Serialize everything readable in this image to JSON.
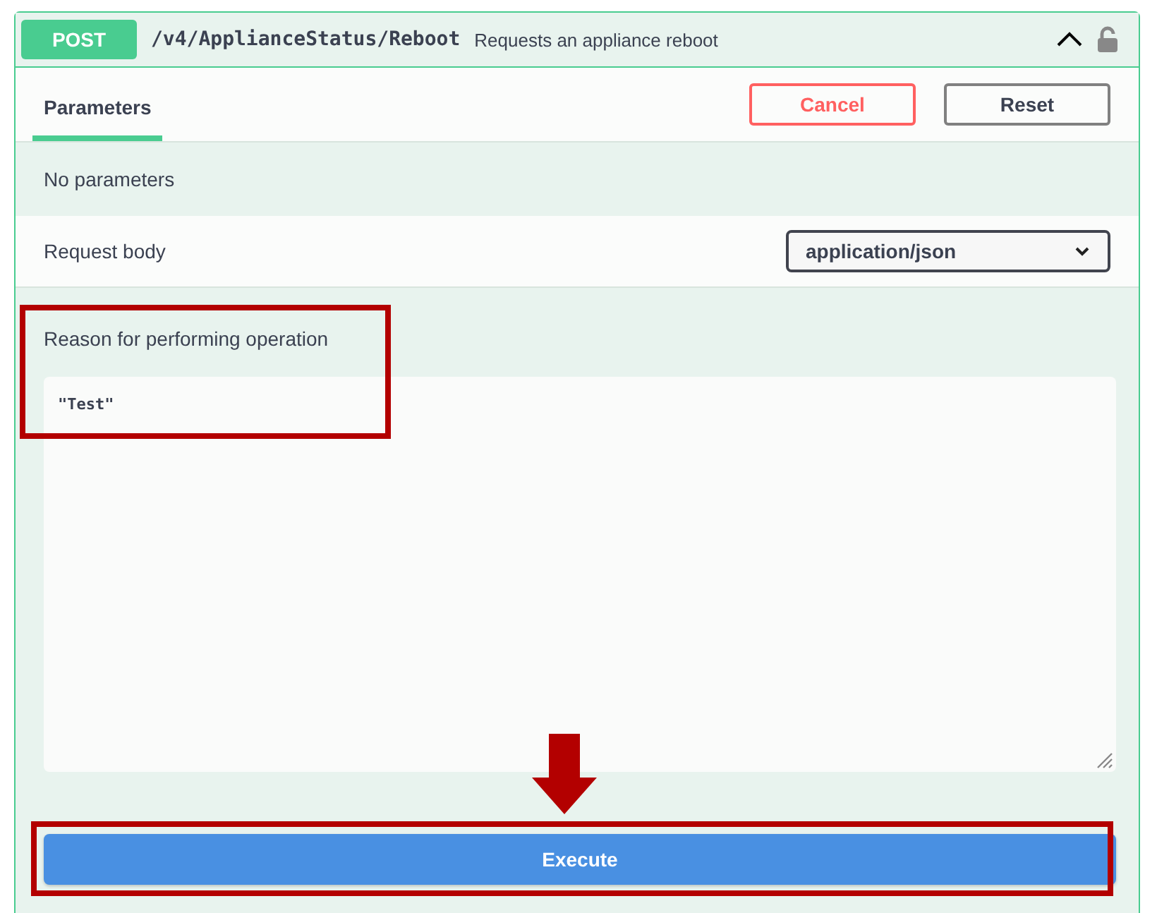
{
  "operation": {
    "method": "POST",
    "path": "/v4/ApplianceStatus/Reboot",
    "summary": "Requests an appliance reboot",
    "expanded": true,
    "locked": false
  },
  "tabs": [
    {
      "label": "Parameters",
      "selected": true
    }
  ],
  "buttons": {
    "cancel": "Cancel",
    "reset": "Reset"
  },
  "parameters_message": "No parameters",
  "request_body": {
    "label": "Request body",
    "content_type": "application/json",
    "description": "Reason for performing operation",
    "value": "\"Test\""
  },
  "execute": "Execute",
  "annotations": [
    {
      "kind": "frame"
    },
    {
      "kind": "arrow"
    },
    {
      "kind": "frame"
    }
  ]
}
